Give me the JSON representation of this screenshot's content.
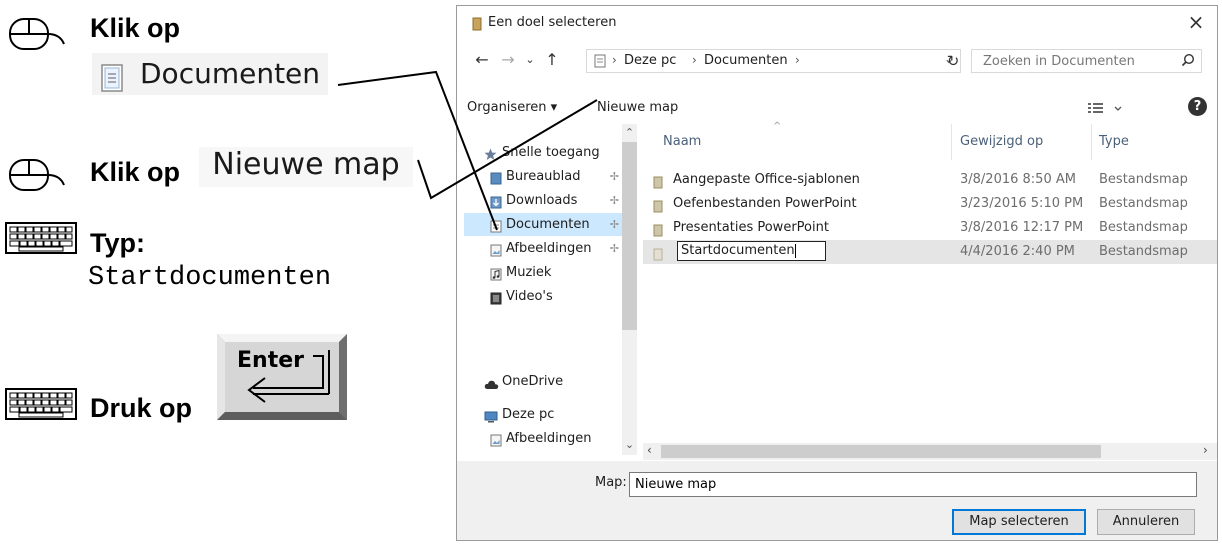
{
  "instructions": {
    "step1": {
      "label": "Klik op",
      "button_text": "Documenten"
    },
    "step2": {
      "label": "Klik op",
      "button_text": "Nieuwe map"
    },
    "step3": {
      "label": "Typ:",
      "typed_text": "Startdocumenten"
    },
    "step4": {
      "label": "Druk op",
      "key_text": "Enter"
    }
  },
  "dialog": {
    "title": "Een doel selecteren",
    "address": {
      "crumbs": [
        "Deze pc",
        "Documenten"
      ]
    },
    "search": {
      "placeholder": "Zoeken in Documenten"
    },
    "commands": {
      "organize": "Organiseren ▾",
      "new_folder": "Nieuwe map"
    },
    "nav_items": [
      {
        "label": "Snelle toegang",
        "icon": "star-icon"
      },
      {
        "label": "Bureaublad",
        "icon": "desktop-folder-icon",
        "pinned": true
      },
      {
        "label": "Downloads",
        "icon": "downloads-folder-icon",
        "pinned": true
      },
      {
        "label": "Documenten",
        "icon": "documents-folder-icon",
        "pinned": true,
        "selected": true
      },
      {
        "label": "Afbeeldingen",
        "icon": "pictures-folder-icon",
        "pinned": true
      },
      {
        "label": "Muziek",
        "icon": "music-folder-icon"
      },
      {
        "label": "Video's",
        "icon": "video-folder-icon"
      },
      {
        "label": "OneDrive",
        "icon": "cloud-icon"
      },
      {
        "label": "Deze pc",
        "icon": "computer-icon"
      },
      {
        "label": "Afbeeldingen",
        "icon": "pictures-folder-icon"
      }
    ],
    "columns": {
      "name": "Naam",
      "modified": "Gewijzigd op",
      "type": "Type"
    },
    "files": [
      {
        "name": "Aangepaste Office-sjablonen",
        "modified": "3/8/2016 8:50 AM",
        "type": "Bestandsmap"
      },
      {
        "name": "Oefenbestanden PowerPoint",
        "modified": "3/23/2016 5:10 PM",
        "type": "Bestandsmap"
      },
      {
        "name": "Presentaties PowerPoint",
        "modified": "3/8/2016 12:17 PM",
        "type": "Bestandsmap"
      },
      {
        "name": "Startdocumenten",
        "modified": "4/4/2016 2:40 PM",
        "type": "Bestandsmap",
        "editing": true
      }
    ],
    "footer": {
      "map_label": "Map:",
      "map_value": "Nieuwe map",
      "select_button": "Map selecteren",
      "cancel_button": "Annuleren"
    }
  }
}
